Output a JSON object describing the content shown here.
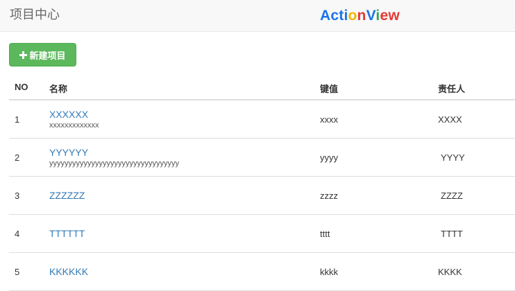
{
  "header": {
    "title": "项目中心",
    "brand": [
      {
        "text": "A",
        "color": "#1a73e8"
      },
      {
        "text": "c",
        "color": "#1a73e8"
      },
      {
        "text": "t",
        "color": "#1a73e8"
      },
      {
        "text": "i",
        "color": "#1a73e8"
      },
      {
        "text": "o",
        "color": "#f4b400"
      },
      {
        "text": "n",
        "color": "#e53935"
      },
      {
        "text": "V",
        "color": "#1a73e8"
      },
      {
        "text": "i",
        "color": "#34a853"
      },
      {
        "text": "e",
        "color": "#e53935"
      },
      {
        "text": "w",
        "color": "#e53935"
      }
    ]
  },
  "toolbar": {
    "new_project_label": "新建项目",
    "new_project_icon": "plus-icon",
    "button_color": "#5cb85c"
  },
  "table": {
    "columns": {
      "no": "NO",
      "name": "名称",
      "key": "键值",
      "owner": "责任人"
    },
    "rows": [
      {
        "no": "1",
        "name": "XXXXXX",
        "desc": "xxxxxxxxxxxxx",
        "key": "xxxx",
        "owner": "XXXX"
      },
      {
        "no": "2",
        "name": "YYYYYY",
        "desc": "yyyyyyyyyyyyyyyyyyyyyyyyyyyyyyyyyy",
        "key": "yyyy",
        "owner": "YYYY"
      },
      {
        "no": "3",
        "name": "ZZZZZZ",
        "desc": "",
        "key": "zzzz",
        "owner": "ZZZZ"
      },
      {
        "no": "4",
        "name": "TTTTTT",
        "desc": "",
        "key": "tttt",
        "owner": "TTTT"
      },
      {
        "no": "5",
        "name": "KKKKKK",
        "desc": "",
        "key": "kkkk",
        "owner": "KKKK"
      }
    ],
    "link_color": "#337ab7"
  }
}
